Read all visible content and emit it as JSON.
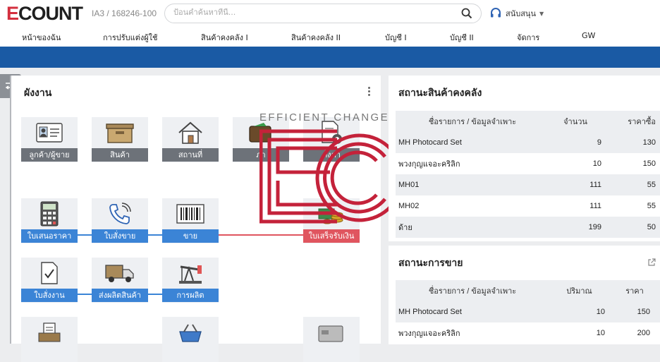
{
  "header": {
    "logo_mark": "E",
    "logo_rest": "COUNT",
    "company_code": "IA3 / 168246-100",
    "search_placeholder": "ป้อนคำค้นหาที่นี่...",
    "support_label": "สนับสนุน"
  },
  "menu": [
    "หน้าของฉัน",
    "การปรับแต่งผู้ใช้",
    "สินค้าคงคลัง I",
    "สินค้าคงคลัง II",
    "บัญชี I",
    "บัญชี II",
    "จัดการ",
    "GW"
  ],
  "workflow": {
    "title": "ผังงาน",
    "tiles": [
      {
        "label": "ลูกค้า/ผู้ขาย",
        "icon": "id-card-icon"
      },
      {
        "label": "สินค้า",
        "icon": "box-icon"
      },
      {
        "label": "สถานที่",
        "icon": "house-icon"
      },
      {
        "label": "ภา",
        "icon": "wallet-icon"
      },
      {
        "label": "ตั้งค่า",
        "icon": "settings-doc-icon"
      },
      {
        "label": "ใบเสนอราคา",
        "icon": "calculator-icon"
      },
      {
        "label": "ใบสั่งขาย",
        "icon": "phone-icon"
      },
      {
        "label": "ขาย",
        "icon": "barcode-icon"
      },
      {
        "label": "ใบเสร็จรับเงิน",
        "icon": "coins-icon"
      },
      {
        "label": "ใบสั่งงาน",
        "icon": "checklist-icon"
      },
      {
        "label": "ส่งผลิตสินค้า",
        "icon": "truck-icon"
      },
      {
        "label": "การผลิต",
        "icon": "oil-pump-icon"
      }
    ]
  },
  "inventory": {
    "title": "สถานะสินค้าคงคลัง",
    "columns": [
      "ชื่อรายการ / ข้อมูลจำเพาะ",
      "จำนวน",
      "ราคาซื้อ"
    ],
    "rows": [
      [
        "MH Photocard Set",
        "9",
        "130"
      ],
      [
        "พวงกุญแจอะคริลิก",
        "10",
        "150"
      ],
      [
        "MH01",
        "111",
        "55"
      ],
      [
        "MH02",
        "111",
        "55"
      ],
      [
        "ด้าย",
        "199",
        "50"
      ]
    ]
  },
  "sales": {
    "title": "สถานะการขาย",
    "columns": [
      "ชื่อรายการ / ข้อมูลจำเพาะ",
      "ปริมาณ",
      "ราคา"
    ],
    "rows": [
      [
        "MH Photocard Set",
        "10",
        "150"
      ],
      [
        "พวงกุญแจอะคริลิก",
        "10",
        "200"
      ]
    ]
  },
  "watermark": {
    "text": "EFFICIENT CHANGE"
  },
  "colors": {
    "brand_red": "#d32f3e",
    "band_blue": "#1a5aa4",
    "tile_gray": "#6d7279",
    "tile_blue": "#3b84d6",
    "tile_red": "#e0555f"
  }
}
